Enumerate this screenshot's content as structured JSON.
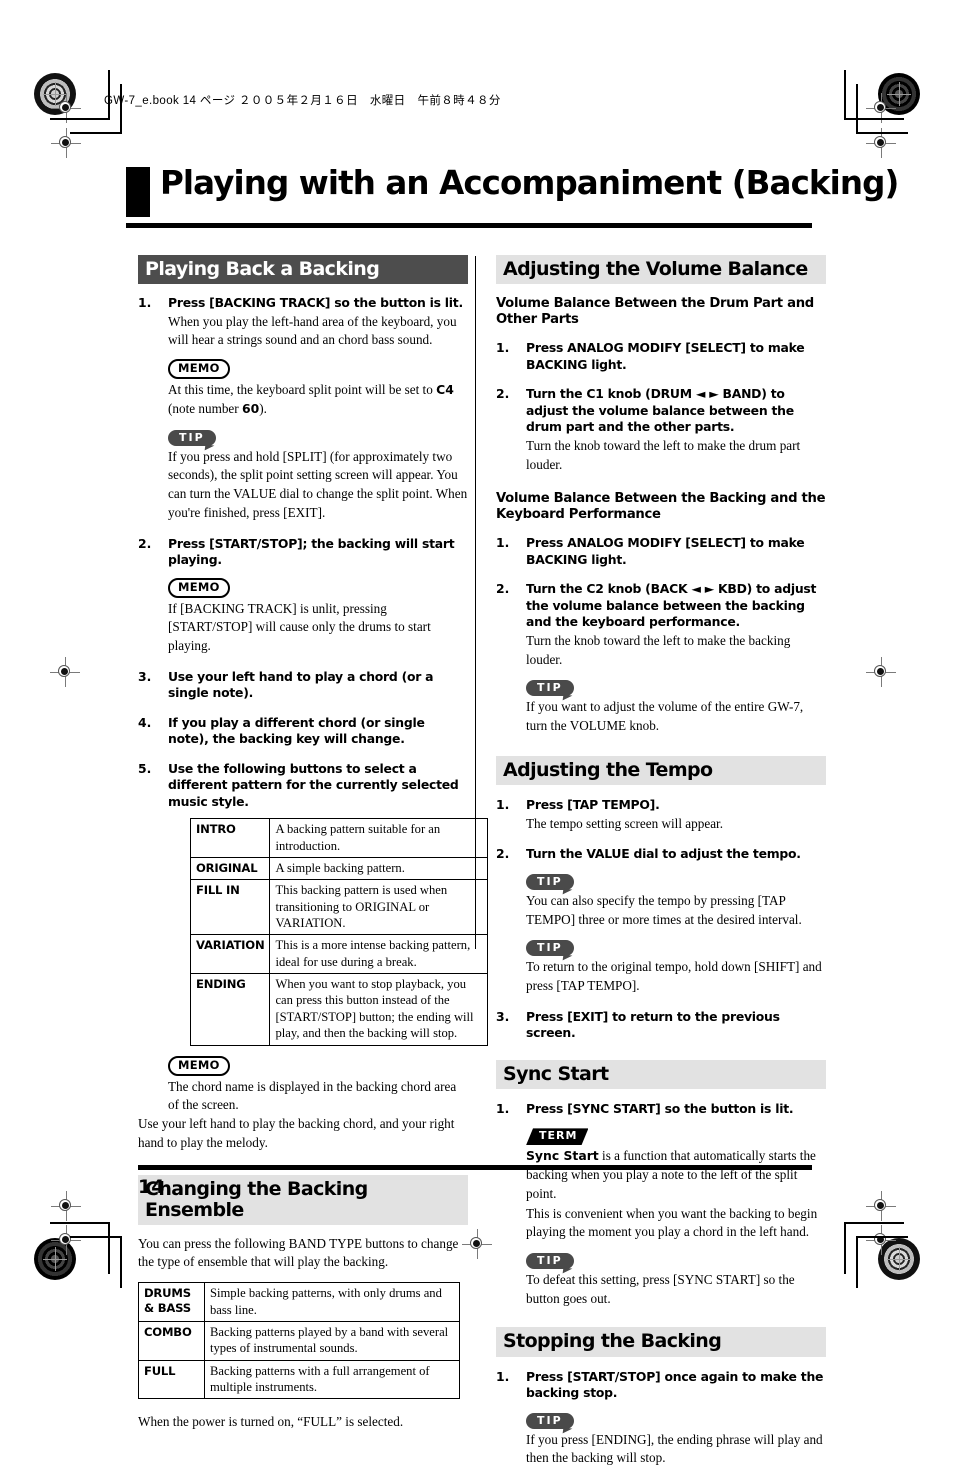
{
  "header_line": "GW-7_e.book 14 ページ ２００５年２月１６日　水曜日　午前８時４８分",
  "title": "Playing with an Accompaniment (Backing)",
  "page_number": "14",
  "badges": {
    "memo": "MEMO",
    "tip": "TIP",
    "term": "TERM"
  },
  "colors": {
    "section_dark": "#4d4d4d",
    "section_light": "#e2e2e2",
    "rule": "#000000"
  },
  "left_column": {
    "section_title": "Playing Back a Backing",
    "steps": [
      {
        "num": "1.",
        "head": "Press [BACKING TRACK] so the button is lit.",
        "body": "When you play the left-hand area of the keyboard, you will hear a strings sound and an chord bass sound.",
        "memo": "At this time, the keyboard split point will be set to C4 (note number 60).",
        "tip": "If you press and hold [SPLIT] (for approximately two seconds), the split point setting screen will appear. You can turn the VALUE dial to change the split point. When you're finished, press [EXIT]."
      },
      {
        "num": "2.",
        "head": "Press [START/STOP]; the backing will start playing.",
        "memo": "If [BACKING TRACK] is unlit, pressing [START/STOP] will cause only the drums to start playing."
      },
      {
        "num": "3.",
        "head": "Use your left hand to play a chord (or a single note)."
      },
      {
        "num": "4.",
        "head": "If you play a different chord (or single note), the backing key will change."
      },
      {
        "num": "5.",
        "head": "Use the following buttons to select a different pattern for the currently selected music style."
      }
    ],
    "pattern_table": [
      {
        "key": "INTRO",
        "desc": "A backing pattern suitable for an introduction."
      },
      {
        "key": "ORIGINAL",
        "desc": "A simple backing pattern."
      },
      {
        "key": "FILL IN",
        "desc": "This backing pattern is used when transitioning to ORIGINAL or VARIATION."
      },
      {
        "key": "VARIATION",
        "desc": "This is a more intense backing pattern, ideal for use during a break."
      },
      {
        "key": "ENDING",
        "desc": "When you want to stop playback, you can press this button instead of the [START/STOP] button; the ending will play, and then the backing will stop."
      }
    ],
    "table_memo": "The chord name is displayed in the backing chord area of the screen.",
    "after_table_note": "Use your left hand to play the backing chord, and your right hand to play the melody.",
    "ensemble_section_title": "Changing the Backing Ensemble",
    "ensemble_intro": "You can press the following BAND TYPE buttons to change the type of ensemble that will play the backing.",
    "ensemble_table": [
      {
        "key": "DRUMS & BASS",
        "desc": "Simple backing patterns, with only drums and bass line."
      },
      {
        "key": "COMBO",
        "desc": "Backing patterns played by a band with several types of instrumental sounds."
      },
      {
        "key": "FULL",
        "desc": "Backing patterns with a full arrangement of multiple instruments."
      }
    ],
    "ensemble_note": "When the power is turned on, “FULL” is selected."
  },
  "right_column": {
    "volume_section_title": "Adjusting the Volume Balance",
    "sub1_title": "Volume Balance Between the Drum Part and Other Parts",
    "sub1_steps": [
      {
        "num": "1.",
        "head": "Press ANALOG MODIFY [SELECT] to make BACKING light."
      },
      {
        "num": "2.",
        "head": "Turn the C1 knob (DRUM ◄ ► BAND) to adjust the volume balance between the drum part and the other parts.",
        "body": "Turn the knob toward the left to make the drum part louder."
      }
    ],
    "sub2_title": "Volume Balance Between the Backing and the Keyboard Performance",
    "sub2_steps": [
      {
        "num": "1.",
        "head": "Press ANALOG MODIFY [SELECT] to make BACKING light."
      },
      {
        "num": "2.",
        "head": "Turn the C2 knob (BACK ◄ ► KBD) to adjust the volume balance between the backing and the keyboard performance.",
        "body": "Turn the knob toward the left to make the backing louder.",
        "tip": "If you want to adjust the volume of the entire GW-7, turn the VOLUME knob."
      }
    ],
    "tempo_section_title": "Adjusting the Tempo",
    "tempo_steps": [
      {
        "num": "1.",
        "head": "Press [TAP TEMPO].",
        "body": "The tempo setting screen will appear."
      },
      {
        "num": "2.",
        "head": "Turn the VALUE dial to adjust the tempo.",
        "tip1": "You can also specify the tempo by pressing [TAP TEMPO] three or more times at the desired interval.",
        "tip2": "To return to the original tempo, hold down [SHIFT] and press [TAP TEMPO]."
      },
      {
        "num": "3.",
        "head": "Press [EXIT] to return to the previous screen."
      }
    ],
    "sync_section_title": "Sync Start",
    "sync_step": {
      "num": "1.",
      "head": "Press [SYNC START] so the button is lit.",
      "term_lead": "Sync Start",
      "term_body": " is a function that automatically starts the backing when you play a note to the left of the split point.",
      "term_body2": "This is convenient when you want the backing to begin playing the moment you play a chord in the left hand.",
      "tip": "To defeat this setting, press [SYNC START] so the button goes out."
    },
    "stop_section_title": "Stopping the Backing",
    "stop_step": {
      "num": "1.",
      "head": "Press [START/STOP] once again to make the backing stop.",
      "tip": "If you press [ENDING], the ending phrase will play and then the backing will stop."
    }
  }
}
